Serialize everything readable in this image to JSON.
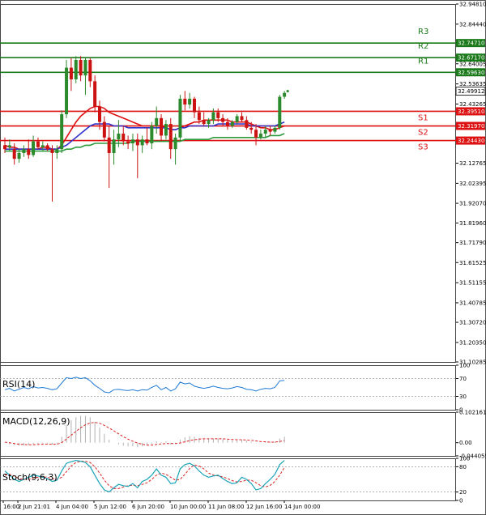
{
  "chart_data": [
    {
      "type": "candlestick",
      "panel": "price",
      "x_tick_labels": [
        "16:00",
        "2 Jun 21:01",
        "4 Jun 04:00",
        "5 Jun 12:00",
        "6 Jun 20:00",
        "10 Jun 00:00",
        "11 Jun 08:00",
        "12 Jun 16:00",
        "14 Jun 00:00"
      ],
      "y_tick_labels": [
        "32.94810",
        "32.84440",
        "32.74710",
        "32.67170",
        "32.64005",
        "32.59630",
        "32.53635",
        "32.49912",
        "32.43265",
        "32.39510",
        "32.31970",
        "32.24430",
        "32.12765",
        "32.02395",
        "31.92070",
        "31.81960",
        "31.71790",
        "31.61525",
        "31.51155",
        "31.40785",
        "31.30720",
        "31.20350",
        "31.10285"
      ],
      "ylim": [
        31.10285,
        32.9481
      ],
      "current_price": 32.49912,
      "levels": [
        {
          "name": "R3",
          "value": 32.7471,
          "color": "#1a7a1a"
        },
        {
          "name": "R2",
          "value": 32.6717,
          "color": "#1a7a1a"
        },
        {
          "name": "R1",
          "value": 32.5963,
          "color": "#1a7a1a"
        },
        {
          "name": "S1",
          "value": 32.3951,
          "color": "#dd1111"
        },
        {
          "name": "S2",
          "value": 32.3197,
          "color": "#dd1111"
        },
        {
          "name": "S3",
          "value": 32.2443,
          "color": "#dd1111"
        }
      ],
      "candles": [
        {
          "o": 32.22,
          "h": 32.26,
          "l": 32.18,
          "c": 32.2
        },
        {
          "o": 32.21,
          "h": 32.25,
          "l": 32.19,
          "c": 32.22
        },
        {
          "o": 32.2,
          "h": 32.23,
          "l": 32.12,
          "c": 32.15
        },
        {
          "o": 32.15,
          "h": 32.2,
          "l": 32.13,
          "c": 32.18
        },
        {
          "o": 32.18,
          "h": 32.22,
          "l": 32.16,
          "c": 32.2
        },
        {
          "o": 32.2,
          "h": 32.25,
          "l": 32.15,
          "c": 32.17
        },
        {
          "o": 32.17,
          "h": 32.27,
          "l": 32.16,
          "c": 32.24
        },
        {
          "o": 32.24,
          "h": 32.26,
          "l": 32.2,
          "c": 32.21
        },
        {
          "o": 32.21,
          "h": 32.24,
          "l": 32.19,
          "c": 32.22
        },
        {
          "o": 32.22,
          "h": 32.23,
          "l": 32.19,
          "c": 32.2
        },
        {
          "o": 32.2,
          "h": 32.22,
          "l": 31.93,
          "c": 32.18
        },
        {
          "o": 32.18,
          "h": 32.22,
          "l": 32.15,
          "c": 32.2
        },
        {
          "o": 32.2,
          "h": 32.4,
          "l": 32.18,
          "c": 32.38
        },
        {
          "o": 32.38,
          "h": 32.66,
          "l": 32.36,
          "c": 32.62
        },
        {
          "o": 32.62,
          "h": 32.67,
          "l": 32.5,
          "c": 32.56
        },
        {
          "o": 32.56,
          "h": 32.68,
          "l": 32.54,
          "c": 32.66
        },
        {
          "o": 32.66,
          "h": 32.68,
          "l": 32.55,
          "c": 32.58
        },
        {
          "o": 32.58,
          "h": 32.67,
          "l": 32.48,
          "c": 32.66
        },
        {
          "o": 32.66,
          "h": 32.67,
          "l": 32.52,
          "c": 32.55
        },
        {
          "o": 32.55,
          "h": 32.58,
          "l": 32.39,
          "c": 32.42
        },
        {
          "o": 32.42,
          "h": 32.45,
          "l": 32.3,
          "c": 32.34
        },
        {
          "o": 32.34,
          "h": 32.37,
          "l": 32.24,
          "c": 32.26
        },
        {
          "o": 32.26,
          "h": 32.32,
          "l": 32.0,
          "c": 32.18
        },
        {
          "o": 32.18,
          "h": 32.3,
          "l": 32.12,
          "c": 32.25
        },
        {
          "o": 32.25,
          "h": 32.35,
          "l": 32.21,
          "c": 32.28
        },
        {
          "o": 32.28,
          "h": 32.32,
          "l": 32.22,
          "c": 32.24
        },
        {
          "o": 32.24,
          "h": 32.27,
          "l": 32.2,
          "c": 32.23
        },
        {
          "o": 32.23,
          "h": 32.28,
          "l": 32.19,
          "c": 32.25
        },
        {
          "o": 32.25,
          "h": 32.28,
          "l": 32.05,
          "c": 32.22
        },
        {
          "o": 32.22,
          "h": 32.27,
          "l": 32.18,
          "c": 32.25
        },
        {
          "o": 32.25,
          "h": 32.31,
          "l": 32.22,
          "c": 32.23
        },
        {
          "o": 32.23,
          "h": 32.34,
          "l": 32.2,
          "c": 32.32
        },
        {
          "o": 32.32,
          "h": 32.42,
          "l": 32.28,
          "c": 32.36
        },
        {
          "o": 32.36,
          "h": 32.38,
          "l": 32.24,
          "c": 32.27
        },
        {
          "o": 32.27,
          "h": 32.35,
          "l": 32.25,
          "c": 32.33
        },
        {
          "o": 32.33,
          "h": 32.36,
          "l": 32.15,
          "c": 32.2
        },
        {
          "o": 32.2,
          "h": 32.28,
          "l": 32.12,
          "c": 32.26
        },
        {
          "o": 32.26,
          "h": 32.48,
          "l": 32.24,
          "c": 32.46
        },
        {
          "o": 32.46,
          "h": 32.5,
          "l": 32.4,
          "c": 32.43
        },
        {
          "o": 32.43,
          "h": 32.49,
          "l": 32.41,
          "c": 32.46
        },
        {
          "o": 32.46,
          "h": 32.47,
          "l": 32.36,
          "c": 32.39
        },
        {
          "o": 32.39,
          "h": 32.42,
          "l": 32.33,
          "c": 32.35
        },
        {
          "o": 32.35,
          "h": 32.39,
          "l": 32.32,
          "c": 32.33
        },
        {
          "o": 32.33,
          "h": 32.36,
          "l": 32.31,
          "c": 32.35
        },
        {
          "o": 32.35,
          "h": 32.41,
          "l": 32.33,
          "c": 32.39
        },
        {
          "o": 32.39,
          "h": 32.41,
          "l": 32.34,
          "c": 32.36
        },
        {
          "o": 32.36,
          "h": 32.38,
          "l": 32.32,
          "c": 32.34
        },
        {
          "o": 32.34,
          "h": 32.36,
          "l": 32.3,
          "c": 32.32
        },
        {
          "o": 32.32,
          "h": 32.35,
          "l": 32.31,
          "c": 32.34
        },
        {
          "o": 32.34,
          "h": 32.38,
          "l": 32.33,
          "c": 32.37
        },
        {
          "o": 32.37,
          "h": 32.39,
          "l": 32.34,
          "c": 32.35
        },
        {
          "o": 32.35,
          "h": 32.37,
          "l": 32.3,
          "c": 32.31
        },
        {
          "o": 32.31,
          "h": 32.34,
          "l": 32.28,
          "c": 32.3
        },
        {
          "o": 32.3,
          "h": 32.33,
          "l": 32.22,
          "c": 32.26
        },
        {
          "o": 32.26,
          "h": 32.3,
          "l": 32.25,
          "c": 32.28
        },
        {
          "o": 32.28,
          "h": 32.32,
          "l": 32.26,
          "c": 32.3
        },
        {
          "o": 32.3,
          "h": 32.32,
          "l": 32.27,
          "c": 32.29
        },
        {
          "o": 32.29,
          "h": 32.32,
          "l": 32.28,
          "c": 32.31
        },
        {
          "o": 32.31,
          "h": 32.48,
          "l": 32.3,
          "c": 32.47
        },
        {
          "o": 32.47,
          "h": 32.5,
          "l": 32.46,
          "c": 32.49
        }
      ],
      "ma_lines": [
        {
          "color": "#dd1111",
          "values": [
            32.22,
            32.21,
            32.21,
            32.2,
            32.2,
            32.2,
            32.2,
            32.2,
            32.21,
            32.21,
            32.2,
            32.2,
            32.22,
            32.26,
            32.3,
            32.34,
            32.37,
            32.39,
            32.41,
            32.42,
            32.42,
            32.41,
            32.39,
            32.38,
            32.37,
            32.36,
            32.35,
            32.34,
            32.33,
            32.32,
            32.32,
            32.32,
            32.32,
            32.32,
            32.31,
            32.3,
            32.3,
            32.31,
            32.32,
            32.33,
            32.34,
            32.34,
            32.35,
            32.35,
            32.35,
            32.35,
            32.35,
            32.35,
            32.34,
            32.34,
            32.34,
            32.34,
            32.33,
            32.32,
            32.31,
            32.31,
            32.3,
            32.3,
            32.31,
            32.32
          ]
        },
        {
          "color": "#3333cc",
          "values": [
            32.2,
            32.2,
            32.2,
            32.2,
            32.2,
            32.2,
            32.2,
            32.2,
            32.2,
            32.2,
            32.2,
            32.2,
            32.21,
            32.22,
            32.24,
            32.26,
            32.28,
            32.3,
            32.32,
            32.33,
            32.33,
            32.33,
            32.33,
            32.32,
            32.32,
            32.32,
            32.31,
            32.31,
            32.31,
            32.31,
            32.31,
            32.31,
            32.31,
            32.31,
            32.31,
            32.3,
            32.3,
            32.31,
            32.31,
            32.32,
            32.32,
            32.32,
            32.32,
            32.32,
            32.32,
            32.33,
            32.33,
            32.33,
            32.33,
            32.33,
            32.33,
            32.33,
            32.32,
            32.32,
            32.32,
            32.32,
            32.32,
            32.32,
            32.33,
            32.34
          ]
        },
        {
          "color": "#2e9b3e",
          "values": [
            32.19,
            32.19,
            32.19,
            32.19,
            32.19,
            32.19,
            32.19,
            32.19,
            32.19,
            32.19,
            32.19,
            32.19,
            32.19,
            32.2,
            32.2,
            32.21,
            32.21,
            32.22,
            32.22,
            32.23,
            32.23,
            32.23,
            32.23,
            32.23,
            32.23,
            32.23,
            32.23,
            32.24,
            32.24,
            32.24,
            32.24,
            32.24,
            32.24,
            32.24,
            32.24,
            32.24,
            32.24,
            32.24,
            32.25,
            32.25,
            32.25,
            32.25,
            32.25,
            32.25,
            32.26,
            32.26,
            32.26,
            32.26,
            32.26,
            32.26,
            32.26,
            32.26,
            32.26,
            32.26,
            32.26,
            32.26,
            32.27,
            32.27,
            32.27,
            32.28
          ]
        }
      ]
    },
    {
      "type": "line",
      "panel": "rsi",
      "title": "RSI(14)",
      "y_tick_labels": [
        "100",
        "70",
        "30",
        "0"
      ],
      "ylim": [
        0,
        100
      ],
      "values": [
        45,
        48,
        42,
        46,
        50,
        47,
        52,
        49,
        50,
        48,
        45,
        47,
        60,
        72,
        70,
        73,
        70,
        72,
        65,
        55,
        48,
        40,
        38,
        45,
        46,
        44,
        43,
        45,
        42,
        45,
        44,
        50,
        55,
        45,
        50,
        42,
        47,
        62,
        58,
        60,
        53,
        50,
        48,
        50,
        53,
        50,
        48,
        47,
        49,
        52,
        50,
        46,
        45,
        42,
        46,
        48,
        47,
        50,
        65,
        66
      ]
    },
    {
      "type": "bar",
      "panel": "macd",
      "title": "MACD(12,26,9)",
      "y_tick_labels": [
        "0.102161",
        "0.00",
        "-0.044055"
      ],
      "ylim": [
        -0.044055,
        0.102161
      ],
      "histogram": [
        0.0,
        -0.005,
        -0.008,
        -0.01,
        -0.009,
        -0.008,
        -0.005,
        -0.004,
        -0.003,
        -0.003,
        -0.006,
        -0.005,
        0.02,
        0.06,
        0.075,
        0.085,
        0.09,
        0.09,
        0.085,
        0.07,
        0.05,
        0.03,
        0.01,
        0.0,
        -0.005,
        -0.01,
        -0.012,
        -0.012,
        -0.015,
        -0.012,
        -0.01,
        -0.005,
        0.005,
        0.002,
        0.004,
        -0.005,
        -0.003,
        0.01,
        0.018,
        0.022,
        0.02,
        0.016,
        0.012,
        0.012,
        0.014,
        0.014,
        0.012,
        0.01,
        0.008,
        0.009,
        0.01,
        0.007,
        0.004,
        0.0,
        0.001,
        0.002,
        0.003,
        0.004,
        0.014,
        0.02
      ],
      "signal": [
        0.002,
        0.0,
        -0.003,
        -0.005,
        -0.006,
        -0.007,
        -0.007,
        -0.006,
        -0.005,
        -0.005,
        -0.005,
        -0.005,
        0.0,
        0.012,
        0.025,
        0.038,
        0.05,
        0.06,
        0.066,
        0.068,
        0.065,
        0.058,
        0.049,
        0.04,
        0.03,
        0.02,
        0.012,
        0.005,
        -0.001,
        -0.005,
        -0.008,
        -0.008,
        -0.006,
        -0.004,
        -0.003,
        -0.003,
        -0.003,
        -0.001,
        0.003,
        0.007,
        0.01,
        0.012,
        0.013,
        0.013,
        0.013,
        0.013,
        0.013,
        0.012,
        0.011,
        0.01,
        0.01,
        0.009,
        0.008,
        0.006,
        0.004,
        0.003,
        0.002,
        0.002,
        0.004,
        0.007
      ]
    },
    {
      "type": "line",
      "panel": "stoch",
      "title": "Stoch(9,6,3)",
      "y_tick_labels": [
        "100",
        "80",
        "20",
        "0"
      ],
      "ylim": [
        0,
        100
      ],
      "main": [
        70,
        60,
        50,
        45,
        50,
        55,
        60,
        58,
        55,
        52,
        45,
        48,
        70,
        88,
        92,
        95,
        93,
        90,
        80,
        60,
        40,
        25,
        20,
        30,
        38,
        35,
        33,
        40,
        30,
        45,
        50,
        60,
        75,
        60,
        55,
        40,
        42,
        75,
        85,
        88,
        82,
        70,
        60,
        55,
        58,
        60,
        52,
        45,
        40,
        42,
        55,
        50,
        40,
        25,
        28,
        40,
        50,
        62,
        85,
        95
      ],
      "signal": [
        60,
        62,
        58,
        52,
        50,
        50,
        53,
        55,
        56,
        55,
        52,
        50,
        55,
        68,
        82,
        90,
        93,
        93,
        90,
        80,
        65,
        48,
        35,
        28,
        28,
        32,
        35,
        36,
        35,
        38,
        42,
        50,
        60,
        65,
        62,
        55,
        48,
        50,
        62,
        76,
        84,
        82,
        75,
        65,
        60,
        58,
        56,
        52,
        47,
        44,
        45,
        48,
        48,
        42,
        35,
        32,
        36,
        45,
        60,
        78
      ]
    }
  ]
}
